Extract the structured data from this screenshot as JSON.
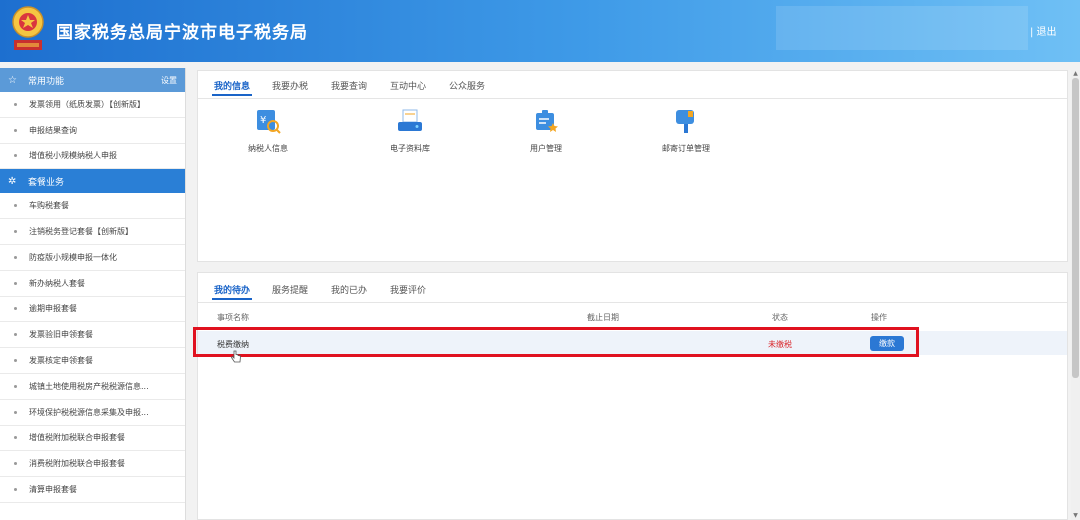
{
  "header": {
    "title": "国家税务总局宁波市电子税务局",
    "logout_label": "| 退出"
  },
  "sidebar": {
    "common": {
      "title": "常用功能",
      "settings_label": "设置"
    },
    "common_items": [
      "发票领用（纸质发票）【创新版】",
      "申报结果查询",
      "增值税小规模纳税人申报"
    ],
    "package": {
      "title": "套餐业务"
    },
    "package_items": [
      "车购税套餐",
      "注销税务登记套餐【创新版】",
      "防疫版小规模申报一体化",
      "新办纳税人套餐",
      "逾期申报套餐",
      "发票验旧申领套餐",
      "发票核定申领套餐",
      "城镇土地使用税房产税税源信息...",
      "环境保护税税源信息采集及申报...",
      "增值税附加税联合申报套餐",
      "消费税附加税联合申报套餐",
      "清算申报套餐"
    ]
  },
  "info_panel": {
    "tabs": [
      "我的信息",
      "我要办税",
      "我要查询",
      "互动中心",
      "公众服务"
    ],
    "apps": [
      {
        "label": "纳税人信息",
        "icon": "taxpayer-info-icon"
      },
      {
        "label": "电子资料库",
        "icon": "e-library-icon"
      },
      {
        "label": "用户管理",
        "icon": "user-management-icon"
      },
      {
        "label": "邮寄订单管理",
        "icon": "mail-order-icon"
      }
    ]
  },
  "todo_panel": {
    "tabs": [
      "我的待办",
      "服务提醒",
      "我的已办",
      "我要评价"
    ],
    "columns": [
      "事项名称",
      "截止日期",
      "状态",
      "操作"
    ],
    "rows": [
      {
        "name": "税费缴纳",
        "deadline": "",
        "status": "未缴税",
        "action": "缴款"
      }
    ]
  },
  "colors": {
    "accent": "#1a64c8",
    "status_unpaid": "#d9252a",
    "highlight_border": "#e0111f"
  }
}
